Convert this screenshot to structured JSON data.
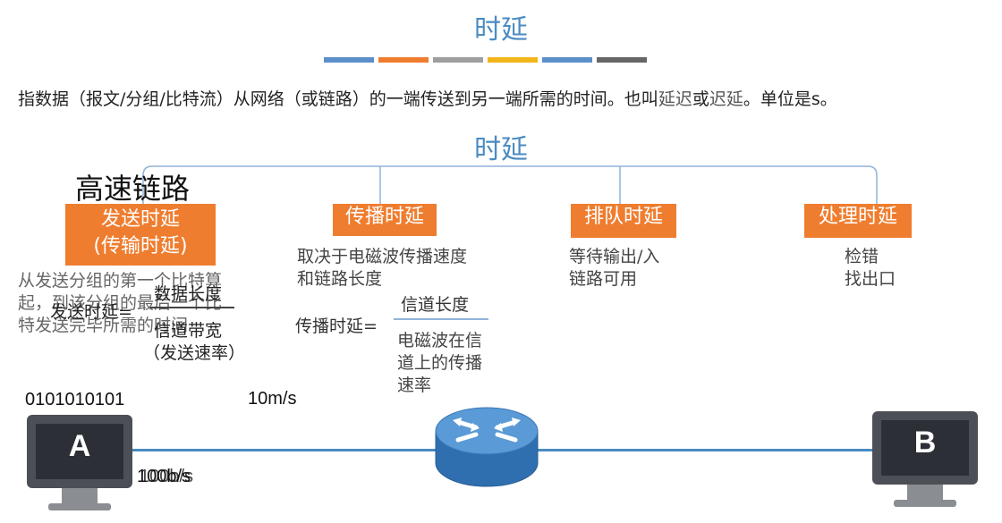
{
  "title": "时延",
  "stripes": [
    "#5b8fc9",
    "#ef7d2f",
    "#9e9e9e",
    "#f2b61a",
    "#5b8fc9",
    "#666666"
  ],
  "definition": {
    "prefix": "指数据（报文/分组/比特流）从网络（或链路）的一端传送到另一端所需的时间。也叫",
    "alt1": "延迟",
    "or": "或",
    "alt2": "迟延",
    "suffix": "。单位是s。"
  },
  "root": "时延",
  "handwritten": "高速链路",
  "categories": [
    {
      "label_line1": "发送时延",
      "label_line2": "(传输时延)"
    },
    {
      "label_line1": "传播时延"
    },
    {
      "label_line1": "排队时延"
    },
    {
      "label_line1": "处理时延"
    }
  ],
  "transmission": {
    "desc_lines": [
      "从发送分组的第一个比特算",
      "起，到该分组的最后一个比",
      "特发送完毕所需的时间"
    ],
    "formula_lhs": "发送时延=",
    "numerator": "数据长度",
    "denominator": "信道带宽",
    "denominator_note": "（发送速率）"
  },
  "propagation": {
    "desc_lines": [
      "取决于电磁波传播速度",
      "和链路长度"
    ],
    "formula_lhs": "传播时延=",
    "numerator": "信道长度",
    "denominator_lines": [
      "电磁波在信",
      "道上的传播",
      "速率"
    ]
  },
  "queuing": {
    "desc_lines": [
      "等待输出/入",
      "链路可用"
    ]
  },
  "processing": {
    "desc_lines": [
      "检错",
      "找出口"
    ]
  },
  "network": {
    "bits": "0101010101",
    "rate_top": "10m/s",
    "rate_overlap": "100b/s",
    "host_a": "A",
    "host_b": "B"
  }
}
